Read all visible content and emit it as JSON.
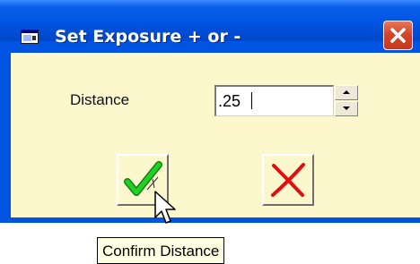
{
  "window": {
    "title": "Set Exposure + or -",
    "icons": {
      "app": "dialog-window-icon",
      "close": "close-icon"
    }
  },
  "form": {
    "distance_label": "Distance",
    "distance_value": ".25"
  },
  "buttons": {
    "ok_icon": "green-checkmark-icon",
    "cancel_icon": "red-x-icon"
  },
  "tooltip": {
    "text": "Confirm Distance"
  },
  "colors": {
    "titlebar": "#0054e3",
    "client_background": "#fcf7cc",
    "close_button": "#d8452a",
    "check": "#22b622",
    "cross": "#e01010",
    "tooltip_background": "#ffffe1"
  }
}
